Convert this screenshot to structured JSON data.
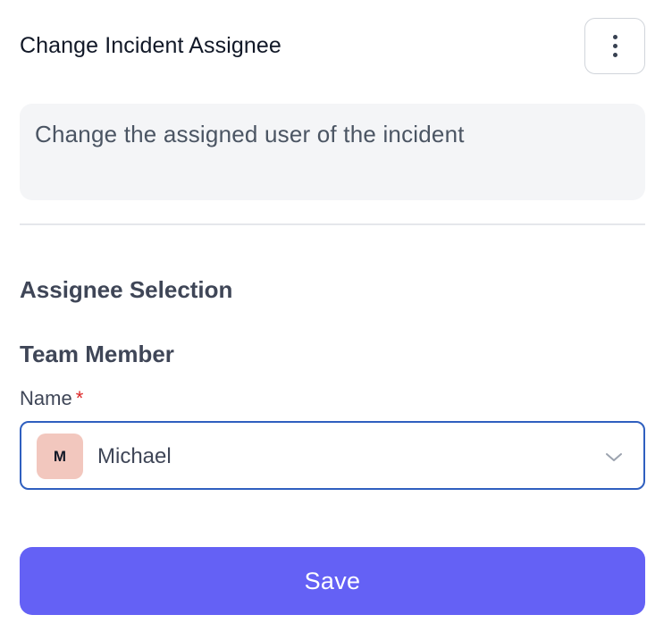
{
  "header": {
    "title": "Change Incident Assignee",
    "menu_icon": "more-vertical-icon"
  },
  "description": {
    "text": "Change the assigned user of the incident"
  },
  "form": {
    "section_title": "Assignee Selection",
    "group_title": "Team Member",
    "name_field": {
      "label": "Name",
      "required_marker": "*",
      "avatar_initial": "M",
      "value": "Michael",
      "chevron_icon": "chevron-down-icon"
    },
    "save_label": "Save"
  },
  "colors": {
    "accent": "#6461f5",
    "focus_border": "#2f5fbf",
    "avatar_bg": "#f2c7be",
    "required": "#dc2626"
  }
}
